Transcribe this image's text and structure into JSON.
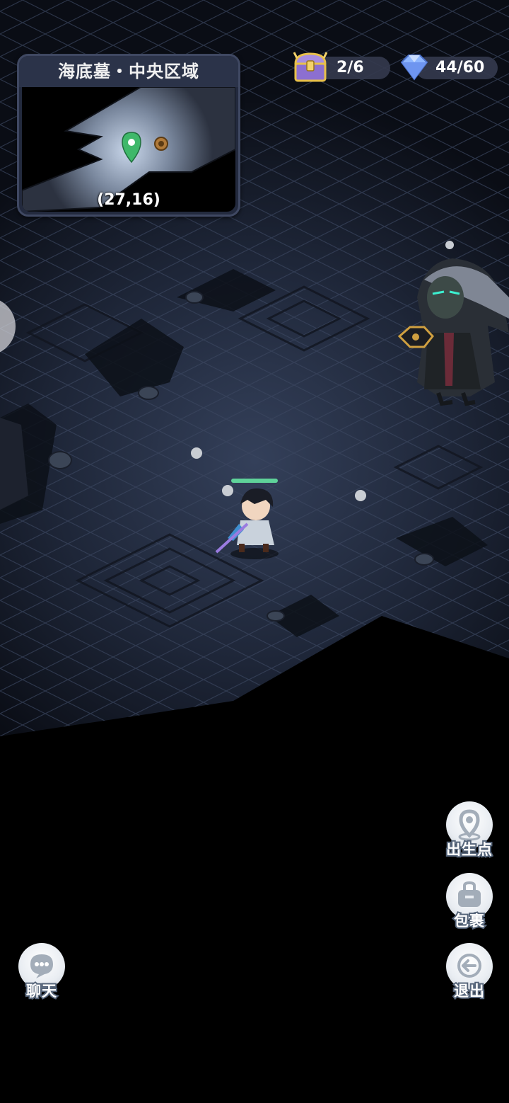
{
  "minimap": {
    "title": "海底墓・中央区域",
    "coords": "(27,16)"
  },
  "resources": {
    "chest_count": "2/6",
    "gem_count": "44/60"
  },
  "buttons": {
    "spawn_label": "出生点",
    "bag_label": "包裹",
    "exit_label": "退出",
    "chat_label": "聊天"
  },
  "icons": {
    "chest": "treasure-chest-icon",
    "gem": "diamond-icon",
    "spawn": "location-pin-icon",
    "bag": "bag-icon",
    "exit": "exit-icon",
    "chat": "chat-bubble-icon"
  },
  "colors": {
    "player_hp": "#5fd39a",
    "map_pin": "#3fb86a",
    "ui_panel": "#2b3349",
    "label_outline": "#56657a"
  }
}
